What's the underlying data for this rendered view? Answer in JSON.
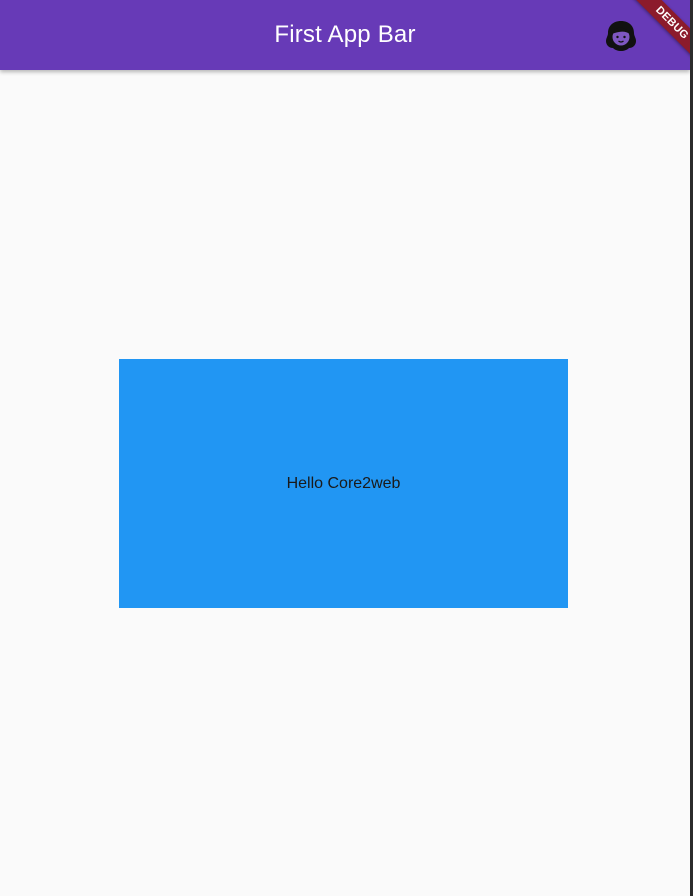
{
  "app_bar": {
    "title": "First App Bar",
    "background_color": "#673ab7",
    "action_icon": "avatar-icon"
  },
  "debug_banner": {
    "label": "DEBUG",
    "color": "#8c1b2c"
  },
  "body": {
    "background_color": "#fafafa",
    "container": {
      "text": "Hello Core2web",
      "color": "#2196f3"
    }
  }
}
